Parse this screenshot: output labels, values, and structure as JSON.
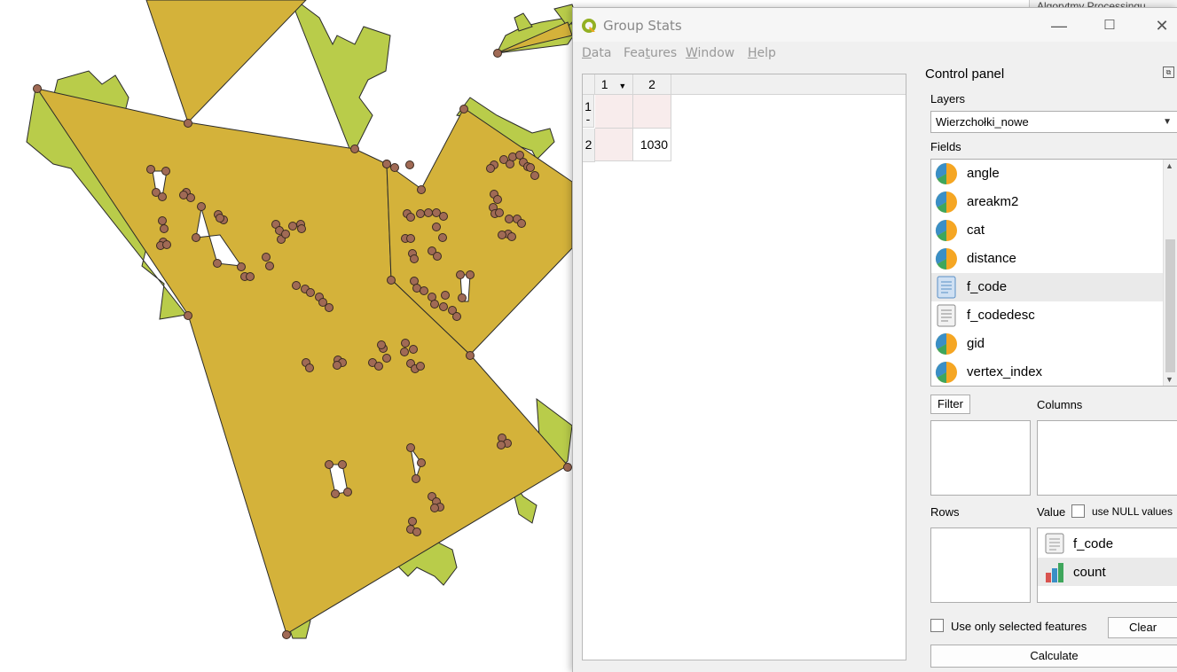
{
  "background_window": {
    "title": "Algorytmy Processingu"
  },
  "window": {
    "title": "Group Stats",
    "minimize_icon": "minimize-icon",
    "maximize_icon": "maximize-icon",
    "close_icon": "close-icon"
  },
  "menu": [
    {
      "label": "Data",
      "ul": "D",
      "rest": "ata"
    },
    {
      "label": "Features",
      "ul": "t",
      "pre": "Fea",
      "rest": "ures"
    },
    {
      "label": "Window",
      "ul": "W",
      "rest": "indow"
    },
    {
      "label": "Help",
      "ul": "H",
      "rest": "elp"
    }
  ],
  "table": {
    "columns": [
      "1",
      "2"
    ],
    "rows": [
      {
        "header": "1\n-",
        "cells": [
          "",
          ""
        ]
      },
      {
        "header": "2",
        "cells": [
          "",
          "1030"
        ]
      }
    ]
  },
  "control_panel": {
    "title": "Control panel",
    "layers_label": "Layers",
    "layer_selected": "Wierzchołki_nowe",
    "fields_label": "Fields",
    "fields": [
      {
        "name": "angle",
        "type": "numeric"
      },
      {
        "name": "areakm2",
        "type": "numeric"
      },
      {
        "name": "cat",
        "type": "numeric"
      },
      {
        "name": "distance",
        "type": "numeric"
      },
      {
        "name": "f_code",
        "type": "text",
        "selected": true
      },
      {
        "name": "f_codedesc",
        "type": "text"
      },
      {
        "name": "gid",
        "type": "numeric"
      },
      {
        "name": "vertex_index",
        "type": "numeric"
      }
    ],
    "filter_label": "Filter",
    "columns_label": "Columns",
    "rows_label": "Rows",
    "value_label": "Value",
    "use_null_label": "use NULL values",
    "value_items": [
      {
        "name": "f_code",
        "icon": "text-field-icon"
      },
      {
        "name": "count",
        "icon": "bar-chart-icon",
        "selected": true
      }
    ],
    "use_selected_label": "Use only selected features",
    "clear_label": "Clear",
    "calculate_label": "Calculate"
  },
  "colors": {
    "polygon_fill": "#d4b23a",
    "green_fill": "#b9cc4a",
    "vertex_fill": "#a06a55",
    "accent_orange": "#f5a623",
    "accent_blue": "#3a8fc6"
  }
}
